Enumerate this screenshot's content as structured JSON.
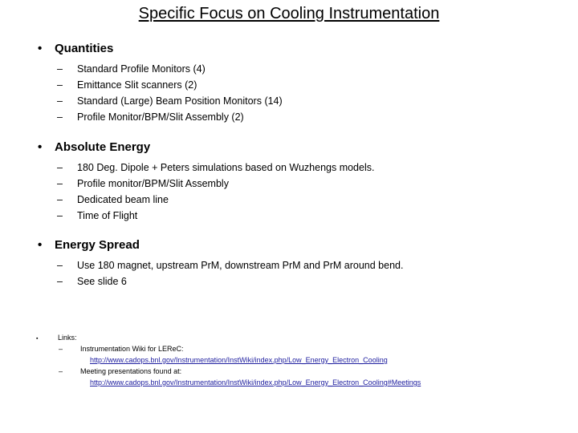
{
  "slide": {
    "title": "Specific Focus on Cooling Instrumentation",
    "background_color": "#FFFFFF",
    "text_color": "#000000",
    "link_color": "#2020A0",
    "bullet_marker_level1": "•",
    "bullet_marker_level2": "–",
    "bullet_marker_small_level1": "▪",
    "sections": [
      {
        "heading": "Quantities",
        "items": [
          "Standard Profile Monitors (4)",
          "Emittance Slit scanners (2)",
          "Standard (Large) Beam Position Monitors (14)",
          "Profile Monitor/BPM/Slit Assembly (2)"
        ]
      },
      {
        "heading": "Absolute Energy",
        "items": [
          "180 Deg. Dipole + Peters simulations based on Wuzhengs models.",
          "Profile monitor/BPM/Slit Assembly",
          "Dedicated beam line",
          "Time of Flight"
        ]
      },
      {
        "heading": "Energy Spread",
        "items": [
          "Use 180 magnet, upstream PrM, downstream PrM and PrM around bend.",
          "See slide 6"
        ]
      }
    ],
    "links_section": {
      "heading": "Links:",
      "entries": [
        {
          "label": "Instrumentation Wiki for LEReC:",
          "url": "http://www.cadops.bnl.gov/Instrumentation/InstWiki/index.php/Low_Energy_Electron_Cooling"
        },
        {
          "label": "Meeting presentations found at:",
          "url": "http://www.cadops.bnl.gov/Instrumentation/InstWiki/index.php/Low_Energy_Electron_Cooling#Meetings"
        }
      ]
    }
  }
}
